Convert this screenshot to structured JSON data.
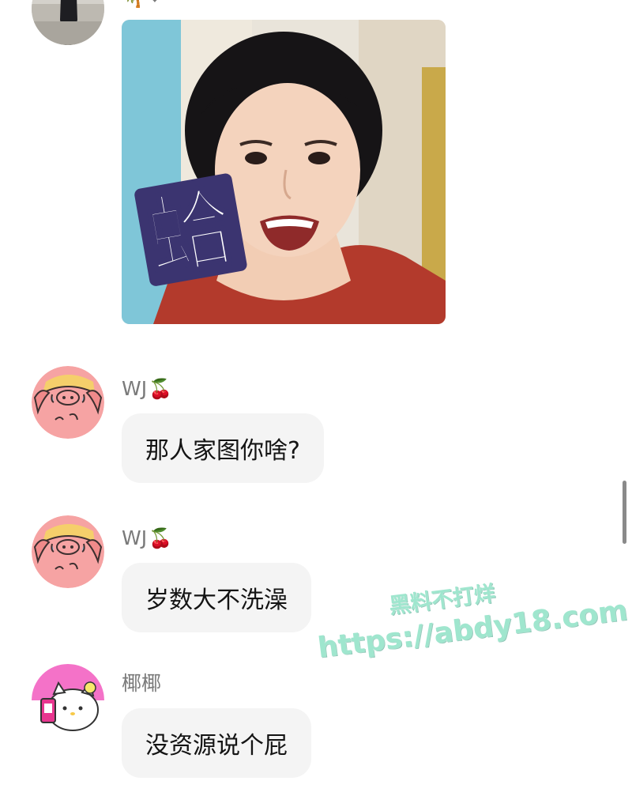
{
  "messages": [
    {
      "sender": "",
      "emoji": "🌴❤",
      "type": "sticker",
      "sticker_text": "蛤",
      "avatar": "photo-avatar"
    },
    {
      "sender": "WJ",
      "emoji": "🍒",
      "type": "text",
      "text": "那人家图你啥?",
      "avatar": "pig-avatar"
    },
    {
      "sender": "WJ",
      "emoji": "🍒",
      "type": "text",
      "text": "岁数大不洗澡",
      "avatar": "pig-avatar"
    },
    {
      "sender": "椰椰",
      "emoji": "",
      "type": "text",
      "text": "没资源说个屁",
      "avatar": "kitty-avatar"
    }
  ],
  "watermark": {
    "line1": "黑料不打烊",
    "line2": "https://abdy18.com"
  },
  "colors": {
    "bubble": "#f4f4f4",
    "name": "#7a7a7a",
    "text": "#141414",
    "watermark": "#9fe6ce",
    "pig_face": "#f6a3a3",
    "pig_hair": "#f5cf6b"
  }
}
